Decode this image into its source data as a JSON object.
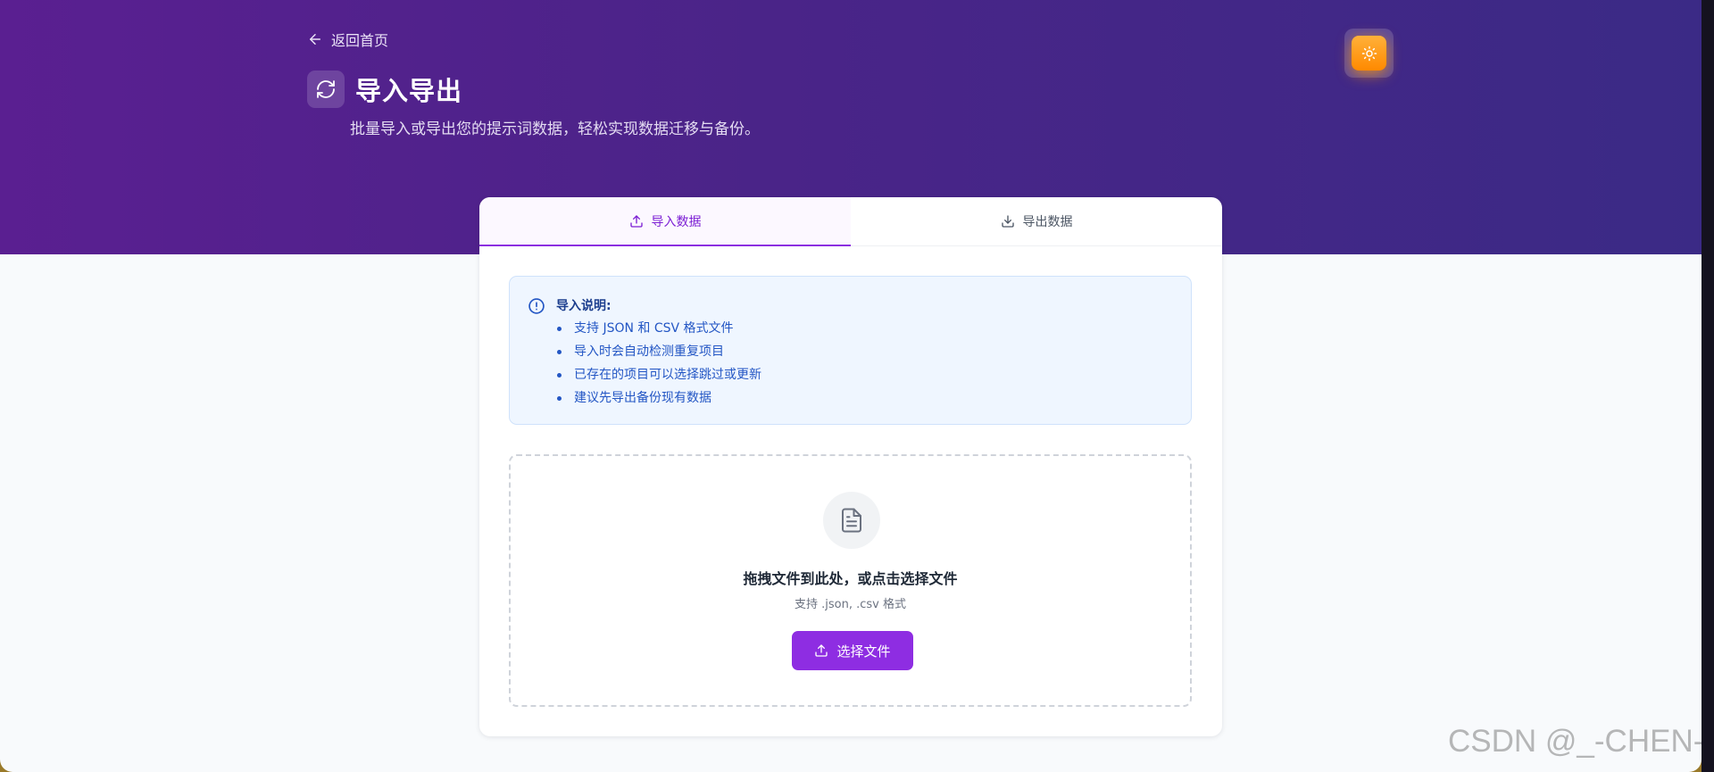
{
  "header": {
    "back_label": "返回首页",
    "title": "导入导出",
    "subtitle": "批量导入或导出您的提示词数据，轻松实现数据迁移与备份。",
    "theme_icon": "sun-icon"
  },
  "tabs": [
    {
      "label": "导入数据",
      "icon": "upload-icon",
      "active": true
    },
    {
      "label": "导出数据",
      "icon": "download-icon",
      "active": false
    }
  ],
  "info": {
    "title": "导入说明:",
    "items": [
      "支持 JSON 和 CSV 格式文件",
      "导入时会自动检测重复项目",
      "已存在的项目可以选择跳过或更新",
      "建议先导出备份现有数据"
    ]
  },
  "dropzone": {
    "title": "拖拽文件到此处，或点击选择文件",
    "subtitle": "支持 .json, .csv 格式",
    "button_label": "选择文件"
  },
  "watermark": "CSDN @_-CHEN-_",
  "colors": {
    "accent": "#8e2de2",
    "hero_start": "#5a1f91",
    "hero_end": "#3b2a86",
    "info_text": "#2356c4",
    "theme_button": "#ff9500"
  }
}
